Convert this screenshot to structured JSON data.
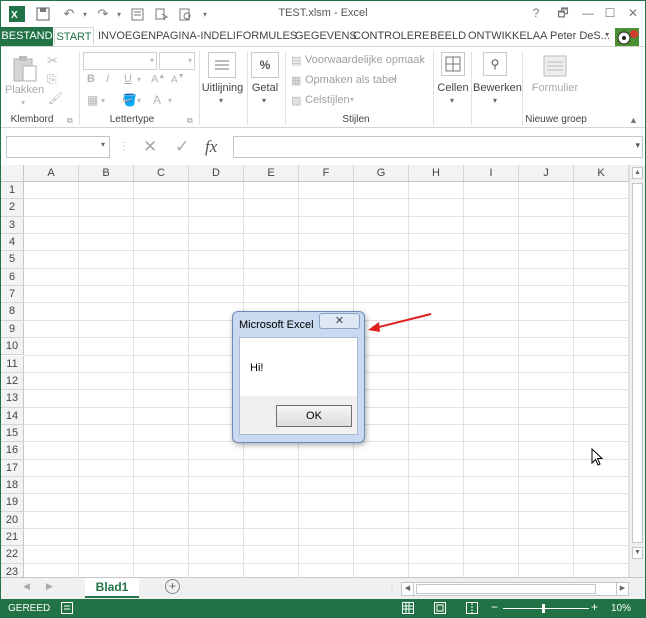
{
  "window": {
    "title": "TEST.xlsm - Excel",
    "help": "?",
    "restore": "🗗",
    "minimize": "—",
    "maximize": "☐",
    "close": "✕"
  },
  "quick_access": {
    "app_icon": "excel-icon",
    "save_icon": "save-icon",
    "undo_icon": "undo-icon",
    "redo_icon": "redo-icon"
  },
  "tabs": [
    {
      "label": "BESTAND"
    },
    {
      "label": "START"
    },
    {
      "label": "INVOEGEN"
    },
    {
      "label": "PAGINA-INDELI"
    },
    {
      "label": "FORMULES"
    },
    {
      "label": "GEGEVENS"
    },
    {
      "label": "CONTROLERE"
    },
    {
      "label": "BEELD"
    },
    {
      "label": "ONTWIKKELAA"
    }
  ],
  "user": {
    "name": "Peter DeS..."
  },
  "ribbon": {
    "clipboard": {
      "paste_label": "Plakken",
      "group_label": "Klembord"
    },
    "font": {
      "group_label": "Lettertype",
      "bold": "B",
      "italic": "I",
      "underline": "U",
      "font_color": "A"
    },
    "alignment": {
      "label": "Uitlijning"
    },
    "number": {
      "label": "Getal",
      "symbol": "%"
    },
    "styles": {
      "group_label": "Stijlen",
      "conditional": "Voorwaardelijke opmaak",
      "format_table": "Opmaken als tabel",
      "cell_styles": "Celstijlen"
    },
    "cells": {
      "label": "Cellen"
    },
    "editing": {
      "label": "Bewerken"
    },
    "custom": {
      "label": "Formulier",
      "group_label": "Nieuwe groep"
    }
  },
  "formula_bar": {
    "fx": "fx",
    "cancel": "✕",
    "enter": "✓"
  },
  "columns": [
    "A",
    "B",
    "C",
    "D",
    "E",
    "F",
    "G",
    "H",
    "I",
    "J",
    "K"
  ],
  "rows": [
    "1",
    "2",
    "3",
    "4",
    "5",
    "6",
    "7",
    "8",
    "9",
    "10",
    "11",
    "12",
    "13",
    "14",
    "15",
    "16",
    "17",
    "18",
    "19",
    "20",
    "21",
    "22",
    "23"
  ],
  "sheet": {
    "tab": "Blad1",
    "add": "+"
  },
  "status": {
    "text": "GEREED",
    "zoom": "10%"
  },
  "dialog": {
    "title": "Microsoft Excel",
    "close": "✕",
    "message": "Hi!",
    "ok": "OK"
  },
  "colors": {
    "accent": "#217346",
    "dialog_frame": "#c9daf0",
    "annotation_arrow": "#e0201c"
  }
}
